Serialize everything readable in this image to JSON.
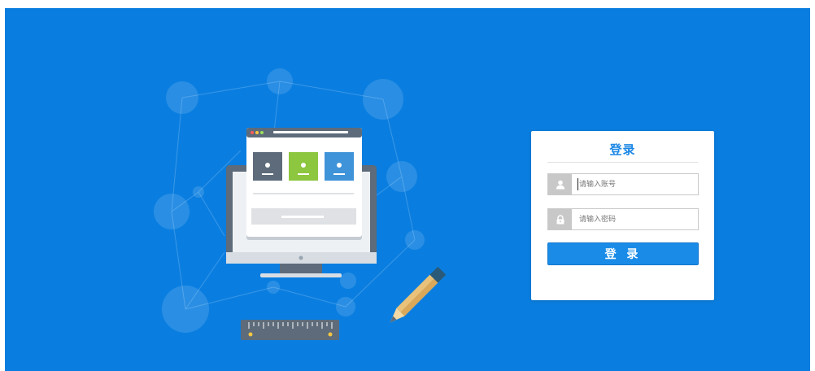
{
  "login": {
    "title": "登录",
    "username_placeholder": "请输入账号",
    "password_placeholder": "请输入密码",
    "submit_label": "登 录"
  },
  "icons": {
    "username": "user-icon",
    "password": "lock-icon"
  },
  "colors": {
    "background": "#0a7ee0",
    "accent": "#1e88e5",
    "button": "#1a8ce8"
  }
}
